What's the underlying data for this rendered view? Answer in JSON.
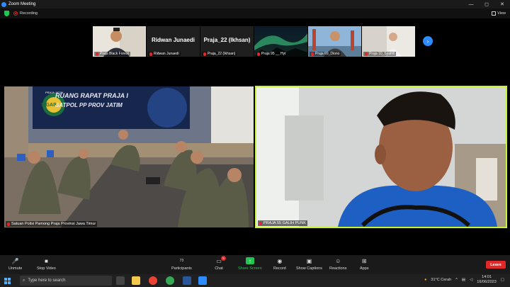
{
  "window": {
    "title": "Zoom Meeting",
    "controls": [
      "—",
      "◻",
      "✕"
    ]
  },
  "meeting_bar": {
    "recording_label": "Recording",
    "view_label": "View"
  },
  "gallery": [
    {
      "big_name": "",
      "caption": "Praja Black Forest",
      "muted": true
    },
    {
      "big_name": "Ridwan Junaedi",
      "caption": "Ridwan Junaedi",
      "muted": true
    },
    {
      "big_name": "Praja_22 (Ikhsan)",
      "caption": "Praja_22 (Ikhsan)",
      "muted": true
    },
    {
      "big_name": "",
      "caption": "Praja 95 __ Hyt",
      "muted": true
    },
    {
      "big_name": "",
      "caption": "Praja 69_Diono",
      "muted": true
    },
    {
      "big_name": "",
      "caption": "Praja 10_Syafrill",
      "muted": true
    }
  ],
  "gallery_next": "›",
  "main_left": {
    "caption": "Satuan Polisi Pamong Praja Provinsi Jawa Timur",
    "banner_line1": "RUANG RAPAT PRAJA I",
    "banner_line2": "SATPOL PP PROV JATIM",
    "logo_text": "SIGAP",
    "logo_top": "PRAJA JATIM"
  },
  "main_right": {
    "caption": "PRAJA 55 GALIH PUNK"
  },
  "toolbar": {
    "unmute": "Unmute",
    "stop_video": "Stop Video",
    "participants": "Participants",
    "participants_count": "73",
    "chat": "Chat",
    "chat_badge": "5",
    "share": "Share Screen",
    "record": "Record",
    "captions": "Show Captions",
    "reactions": "Reactions",
    "apps": "Apps",
    "leave": "Leave"
  },
  "taskbar": {
    "search_placeholder": "Type here to search",
    "weather": "31°C  Cerah",
    "time": "14:01",
    "date": "16/06/2023"
  },
  "colors": {
    "accent_blue": "#2d8cff",
    "active_speaker": "#c6f23a",
    "leave_red": "#e02828",
    "share_green": "#23c552"
  }
}
